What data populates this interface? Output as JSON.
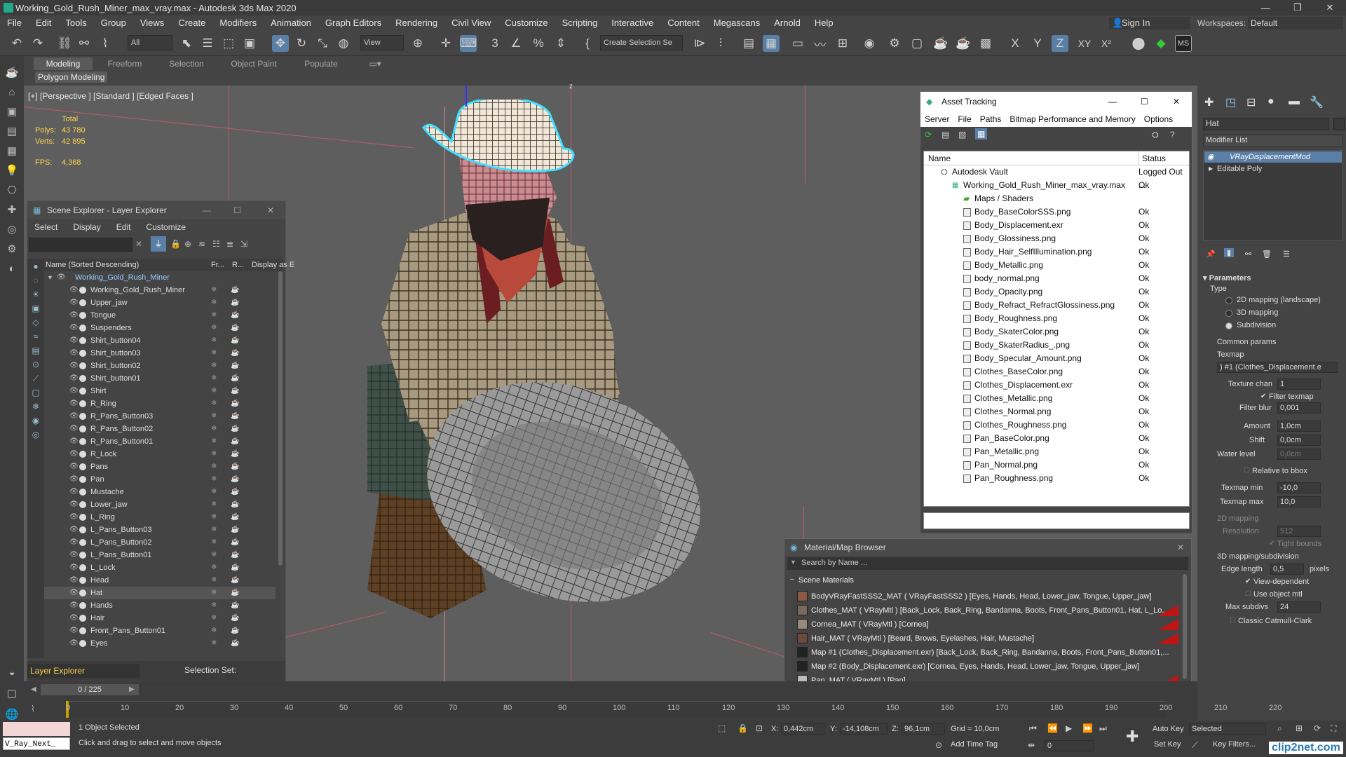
{
  "title_bar": {
    "title": "Working_Gold_Rush_Miner_max_vray.max - Autodesk 3ds Max 2020",
    "min": "—",
    "max": "❐",
    "close": "✕"
  },
  "menu": [
    "File",
    "Edit",
    "Tools",
    "Group",
    "Views",
    "Create",
    "Modifiers",
    "Animation",
    "Graph Editors",
    "Rendering",
    "Civil View",
    "Customize",
    "Scripting",
    "Interactive",
    "Content",
    "Megascans",
    "Arnold",
    "Help"
  ],
  "sign_in": "Sign In",
  "workspaces": {
    "label": "Workspaces:",
    "value": "Default"
  },
  "toolbar": {
    "filter_all": "All",
    "view_dd": "View",
    "selection_set": "Create Selection Se",
    "axis_x": "X",
    "axis_y": "Y",
    "axis_z": "Z",
    "axis_xy": "XY",
    "axis_xp": "X²",
    "ms": "MS"
  },
  "ribbon": {
    "tabs": [
      "Modeling",
      "Freeform",
      "Selection",
      "Object Paint",
      "Populate"
    ],
    "sub": "Polygon Modeling"
  },
  "viewport": {
    "label": "[+] [Perspective ] [Standard ] [Edged Faces ]",
    "total": "Total",
    "polys_label": "Polys:",
    "polys": "43 780",
    "verts_label": "Verts:",
    "verts": "42 895",
    "fps_label": "FPS:",
    "fps": "4,368",
    "axis_z": "z"
  },
  "scene_explorer": {
    "title": "Scene Explorer - Layer Explorer",
    "menu": [
      "Select",
      "Display",
      "Edit",
      "Customize"
    ],
    "col_name": "Name (Sorted Descending)",
    "col_fr": "Fr...",
    "col_r": "R...",
    "col_disp": "Display as E",
    "root": "Working_Gold_Rush_Miner",
    "items": [
      "Working_Gold_Rush_Miner",
      "Upper_jaw",
      "Tongue",
      "Suspenders",
      "Shirt_button04",
      "Shirt_button03",
      "Shirt_button02",
      "Shirt_button01",
      "Shirt",
      "R_Ring",
      "R_Pans_Button03",
      "R_Pans_Button02",
      "R_Pans_Button01",
      "R_Lock",
      "Pans",
      "Pan",
      "Mustache",
      "Lower_jaw",
      "L_Ring",
      "L_Pans_Button03",
      "L_Pans_Button02",
      "L_Pans_Button01",
      "L_Lock",
      "Head",
      "Hat",
      "Hands",
      "Hair",
      "Front_Pans_Button01",
      "Eyes"
    ],
    "selected": "Hat",
    "footer_explorer": "Layer Explorer",
    "footer_selset": "Selection Set:"
  },
  "asset_tracking": {
    "title": "Asset Tracking",
    "menu": [
      "Server",
      "File",
      "Paths",
      "Bitmap Performance and Memory",
      "Options"
    ],
    "col_name": "Name",
    "col_status": "Status",
    "vault": {
      "name": "Autodesk Vault",
      "status": "Logged Out ..."
    },
    "file": {
      "name": "Working_Gold_Rush_Miner_max_vray.max",
      "status": "Ok"
    },
    "folder": "Maps / Shaders",
    "maps": [
      {
        "name": "Body_BaseColorSSS.png",
        "status": "Ok"
      },
      {
        "name": "Body_Displacement.exr",
        "status": "Ok"
      },
      {
        "name": "Body_Glossiness.png",
        "status": "Ok"
      },
      {
        "name": "Body_Hair_SelfIllumination.png",
        "status": "Ok"
      },
      {
        "name": "Body_Metallic.png",
        "status": "Ok"
      },
      {
        "name": "body_normal.png",
        "status": "Ok"
      },
      {
        "name": "Body_Opacity.png",
        "status": "Ok"
      },
      {
        "name": "Body_Refract_RefractGlossiness.png",
        "status": "Ok"
      },
      {
        "name": "Body_Roughness.png",
        "status": "Ok"
      },
      {
        "name": "Body_SkaterColor.png",
        "status": "Ok"
      },
      {
        "name": "Body_SkaterRadius_.png",
        "status": "Ok"
      },
      {
        "name": "Body_Specular_Amount.png",
        "status": "Ok"
      },
      {
        "name": "Clothes_BaseColor.png",
        "status": "Ok"
      },
      {
        "name": "Clothes_Displacement.exr",
        "status": "Ok"
      },
      {
        "name": "Clothes_Metallic.png",
        "status": "Ok"
      },
      {
        "name": "Clothes_Normal.png",
        "status": "Ok"
      },
      {
        "name": "Clothes_Roughness.png",
        "status": "Ok"
      },
      {
        "name": "Pan_BaseColor.png",
        "status": "Ok"
      },
      {
        "name": "Pan_Metallic.png",
        "status": "Ok"
      },
      {
        "name": "Pan_Normal.png",
        "status": "Ok"
      },
      {
        "name": "Pan_Roughness.png",
        "status": "Ok"
      }
    ]
  },
  "material_browser": {
    "title": "Material/Map Browser",
    "search_placeholder": "Search by Name ...",
    "group": "Scene Materials",
    "items": [
      {
        "label": "BodyVRayFastSSS2_MAT  ( VRayFastSSS2 )  [Eyes, Hands, Head, Lower_jaw, Tongue, Upper_jaw]",
        "swatch": "#8a5a44",
        "red": false
      },
      {
        "label": "Clothes_MAT  ( VRayMtl )  [Back_Lock, Back_Ring, Bandanna, Boots, Front_Pans_Button01, Hat, L_Lo...",
        "swatch": "#7a6a5a",
        "red": true
      },
      {
        "label": "Cornea_MAT  ( VRayMtl )  [Cornea]",
        "swatch": "#9a8a7a",
        "red": true
      },
      {
        "label": "Hair_MAT  ( VRayMtl )  [Beard, Brows, Eyelashes, Hair, Mustache]",
        "swatch": "#6a4a3a",
        "red": true
      },
      {
        "label": "Map #1 (Clothes_Displacement.exr)  [Back_Lock, Back_Ring, Bandanna, Boots, Front_Pans_Button01,...",
        "swatch": "#222222",
        "red": false
      },
      {
        "label": "Map #2 (Body_Displacement.exr)  [Cornea, Eyes, Hands, Head, Lower_jaw, Tongue, Upper_jaw]",
        "swatch": "#222222",
        "red": false
      },
      {
        "label": "Pan_MAT  ( VRayMtl )  [Pan]",
        "swatch": "#bbbbbb",
        "red": true
      }
    ]
  },
  "command_panel": {
    "object_name": "Hat",
    "modifier_list": "Modifier List",
    "stack": [
      "VRayDisplacementMod",
      "Editable Poly"
    ],
    "parameters": "Parameters",
    "type_label": "Type",
    "types": [
      "2D mapping (landscape)",
      "3D mapping",
      "Subdivision"
    ],
    "type_selected": "Subdivision",
    "common": "Common params",
    "texmap": "Texmap",
    "texmap_val": ") #1 (Clothes_Displacement.e",
    "texture_chan_label": "Texture chan",
    "texture_chan": "1",
    "filter_texmap": "Filter texmap",
    "filter_blur_label": "Filter blur",
    "filter_blur": "0,001",
    "amount_label": "Amount",
    "amount": "1,0cm",
    "shift_label": "Shift",
    "shift": "0,0cm",
    "water_label": "Water level",
    "water": "0,0cm",
    "relative": "Relative to bbox",
    "texmap_min_label": "Texmap min",
    "texmap_min": "-10,0",
    "texmap_max_label": "Texmap max",
    "texmap_max": "10,0",
    "map2d": "2D mapping",
    "resolution_label": "Resolution",
    "resolution": "512",
    "tight": "Tight bounds",
    "map3d": "3D mapping/subdivision",
    "edge_label": "Edge length",
    "edge": "0,5",
    "pixels": "pixels",
    "view_dep": "View-dependent",
    "use_obj": "Use object mtl",
    "max_subdiv_label": "Max subdivs",
    "max_subdiv": "24",
    "catmull": "Classic Catmull-Clark"
  },
  "timeline": {
    "frame": "0 / 225",
    "ticks": [
      "0",
      "10",
      "20",
      "30",
      "40",
      "50",
      "60",
      "70",
      "80",
      "90",
      "100",
      "110",
      "120",
      "130",
      "140",
      "150",
      "160",
      "170",
      "180",
      "190",
      "200",
      "210",
      "220"
    ]
  },
  "status": {
    "script": "V_Ray_Next_",
    "selected": "1 Object Selected",
    "hint": "Click and drag to select and move objects",
    "x_label": "X:",
    "x": "0,442cm",
    "y_label": "Y:",
    "y": "-14,108cm",
    "z_label": "Z:",
    "z": "96,1cm",
    "grid": "Grid = 10,0cm",
    "add_time_tag": "Add Time Tag",
    "auto_key": "Auto Key",
    "set_key": "Set Key",
    "selected_dd": "Selected",
    "key_filters": "Key Filters...",
    "frame_field": "0",
    "watermark": "clip2net.com"
  }
}
